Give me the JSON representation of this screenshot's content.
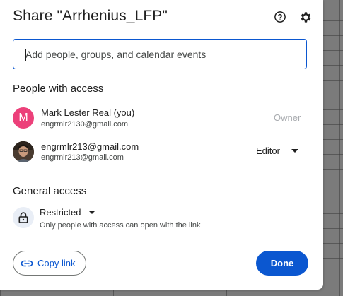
{
  "dialog": {
    "title": "Share \"Arrhenius_LFP\"",
    "help_icon": "help-circle-icon",
    "settings_icon": "gear-icon"
  },
  "add_people": {
    "placeholder": "Add people, groups, and calendar events",
    "value": ""
  },
  "people_section": {
    "heading": "People with access",
    "people": [
      {
        "avatar_letter": "M",
        "avatar_color": "#ec407a",
        "name": "Mark Lester Real (you)",
        "email": "engrmlr2130@gmail.com",
        "role": "Owner"
      },
      {
        "avatar_type": "photo",
        "name": "engrmlr213@gmail.com",
        "email": "engrmlr213@gmail.com",
        "role": "Editor"
      }
    ]
  },
  "general_access": {
    "heading": "General access",
    "icon": "lock-icon",
    "setting": "Restricted",
    "description": "Only people with access can open with the link"
  },
  "footer": {
    "copy_link_label": "Copy link",
    "copy_link_icon": "link-icon",
    "done_label": "Done"
  },
  "colors": {
    "accent": "#0b57d0",
    "owner_text": "#a8abaf",
    "lock_bg": "#e9eef6"
  }
}
